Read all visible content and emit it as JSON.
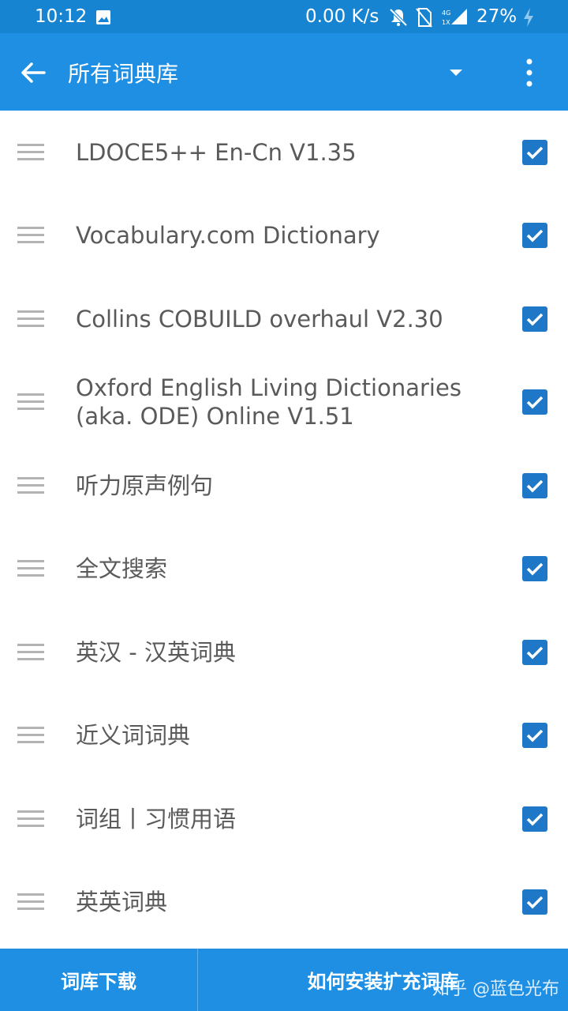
{
  "statusbar": {
    "time": "10:12",
    "net_speed": "0.00 K/s",
    "battery": "27%"
  },
  "appbar": {
    "title": "所有词典库"
  },
  "dictionaries": [
    {
      "label": "LDOCE5++ En-Cn V1.35",
      "checked": true
    },
    {
      "label": "Vocabulary.com Dictionary",
      "checked": true
    },
    {
      "label": "Collins COBUILD overhaul V2.30",
      "checked": true
    },
    {
      "label": "Oxford English Living Dictionaries (aka. ODE) Online V1.51",
      "checked": true
    },
    {
      "label": "听力原声例句",
      "checked": true
    },
    {
      "label": "全文搜索",
      "checked": true
    },
    {
      "label": "英汉 - 汉英词典",
      "checked": true
    },
    {
      "label": "近义词词典",
      "checked": true
    },
    {
      "label": "词组丨习惯用语",
      "checked": true
    },
    {
      "label": "英英词典",
      "checked": true
    }
  ],
  "bottom": {
    "download_label": "词库下载",
    "install_label": "如何安装扩充词库"
  },
  "watermark": "知乎 @蓝色光布",
  "colors": {
    "primary": "#1f8fe3",
    "statusbar": "#1784d1",
    "checkbox": "#1f78c7"
  }
}
